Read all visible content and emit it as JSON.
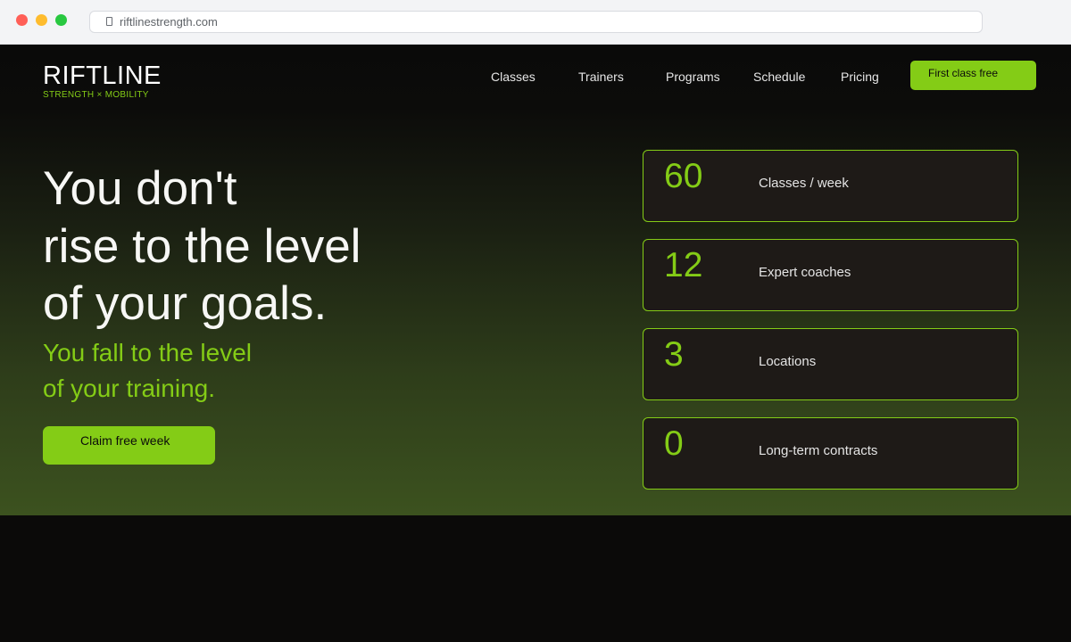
{
  "browser": {
    "url": "riftlinestrength.com"
  },
  "brand": {
    "name": "RIFTLINE",
    "tagline": "STRENGTH × MOBILITY"
  },
  "nav": {
    "items": [
      {
        "label": "Classes"
      },
      {
        "label": "Trainers"
      },
      {
        "label": "Programs"
      },
      {
        "label": "Schedule"
      },
      {
        "label": "Pricing"
      }
    ],
    "cta_label": "First class free"
  },
  "hero": {
    "headline_lines": [
      "You don't",
      "rise to the level",
      "of your goals."
    ],
    "subline_lines": [
      "You fall to the level",
      "of your training."
    ],
    "cta_label": "Claim free week"
  },
  "stats": [
    {
      "value": "60",
      "label": "Classes / week"
    },
    {
      "value": "12",
      "label": "Expert coaches"
    },
    {
      "value": "3",
      "label": "Locations"
    },
    {
      "value": "0",
      "label": "Long-term contracts"
    }
  ],
  "colors": {
    "accent": "#84cc16",
    "background": "#0b0a09",
    "card": "#1e1a17"
  }
}
